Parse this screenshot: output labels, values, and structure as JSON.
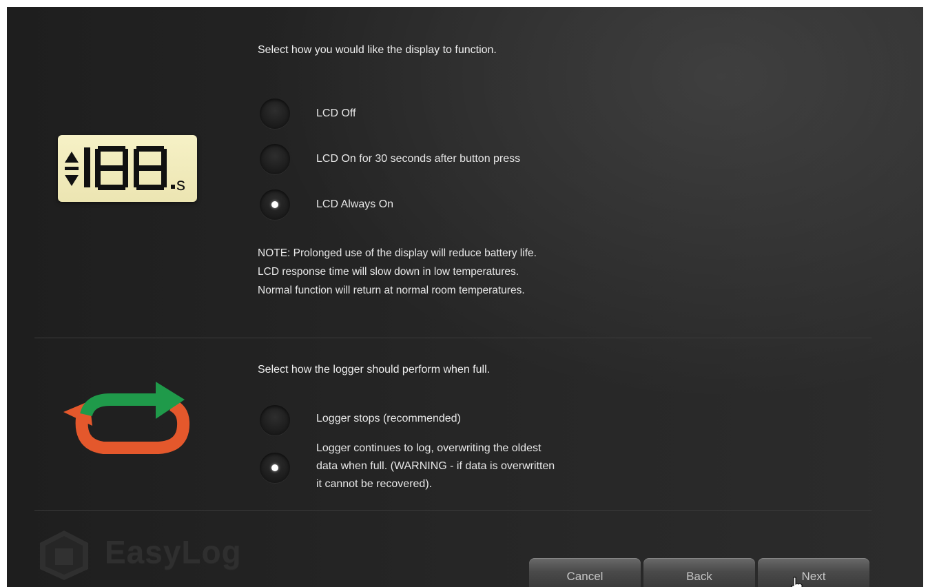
{
  "display_section": {
    "heading": "Select how you would like the display to function.",
    "lcd_icon": "lcd-display-icon",
    "options": [
      {
        "label": "LCD Off",
        "selected": false
      },
      {
        "label": "LCD On for 30 seconds after button press",
        "selected": false
      },
      {
        "label": "LCD Always On",
        "selected": true
      }
    ],
    "note_lines": [
      "NOTE: Prolonged use of the display will reduce battery life.",
      "LCD response time will slow down in low temperatures.",
      "Normal function will return at normal room temperatures."
    ]
  },
  "logger_section": {
    "heading": "Select how the logger should perform when full.",
    "icon": "loop-arrows-icon",
    "options": [
      {
        "label": "Logger stops (recommended)",
        "selected": false
      },
      {
        "label_lines": [
          "Logger continues to log, overwriting the oldest",
          "data when full. (WARNING - if data is overwritten",
          "it cannot be recovered)."
        ],
        "selected": true
      }
    ]
  },
  "footer": {
    "brand": "EasyLog",
    "buttons": {
      "cancel": "Cancel",
      "back": "Back",
      "next": "Next"
    }
  },
  "colors": {
    "background": "#262626",
    "lcd_background": "#f3eec0",
    "arrow_green": "#1f9a4a",
    "arrow_orange": "#e4582c"
  }
}
